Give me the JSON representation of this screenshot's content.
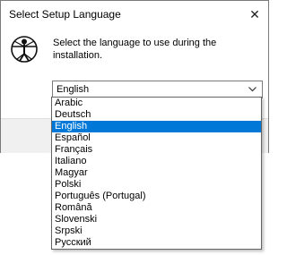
{
  "window": {
    "title": "Select Setup Language",
    "close_glyph": "✕"
  },
  "dialog": {
    "prompt": "Select the language to use during the installation.",
    "logo_icon": "vitruvian-man-icon"
  },
  "language_select": {
    "selected_value": "English",
    "arrow_icon": "chevron-down-icon",
    "options": [
      "Arabic",
      "Deutsch",
      "English",
      "Español",
      "Français",
      "Italiano",
      "Magyar",
      "Polski",
      "Português (Portugal)",
      "Română",
      "Slovenski",
      "Srpski",
      "Русский"
    ],
    "highlighted_index": 2
  },
  "colors": {
    "selection_bg": "#0078d7",
    "selection_fg": "#ffffff",
    "footer_bg": "#f0f0f0"
  }
}
